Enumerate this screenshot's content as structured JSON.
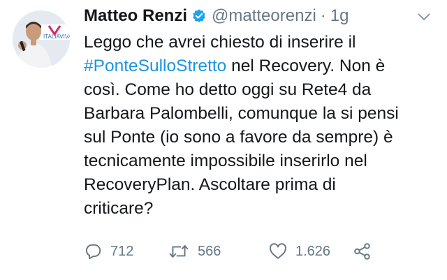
{
  "tweet": {
    "author_name": "Matteo Renzi",
    "handle": "@matteorenzi",
    "separator": "·",
    "time": "1g",
    "verified_icon": "verified-badge-icon",
    "avatar_banner_text": "ITALIAVIVA",
    "lines": [
      {
        "before": "Leggo che avrei chiesto di inserire il",
        "hashtag": "",
        "after": ""
      },
      {
        "before": "",
        "hashtag": "#PonteSulloStretto",
        "after": " nel Recovery. Non è"
      },
      {
        "before": "così. Come ho detto oggi su Rete4 da",
        "hashtag": "",
        "after": ""
      },
      {
        "before": "Barbara Palombelli, comunque la si pensi",
        "hashtag": "",
        "after": ""
      },
      {
        "before": "sul Ponte (io sono a favore da sempre) è",
        "hashtag": "",
        "after": ""
      },
      {
        "before": "tecnicamente impossibile inserirlo nel",
        "hashtag": "",
        "after": ""
      },
      {
        "before": "RecoveryPlan. Ascoltare prima di",
        "hashtag": "",
        "after": ""
      },
      {
        "before": "criticare?",
        "hashtag": "",
        "after": ""
      }
    ],
    "actions": {
      "replies": "712",
      "retweets": "566",
      "likes": "1.626"
    },
    "colors": {
      "text": "#14171a",
      "muted": "#657786",
      "link": "#1b95e0",
      "verified": "#1da1f2"
    },
    "icons": [
      "reply-icon",
      "retweet-icon",
      "like-icon",
      "share-icon",
      "chevron-down-icon"
    ]
  }
}
